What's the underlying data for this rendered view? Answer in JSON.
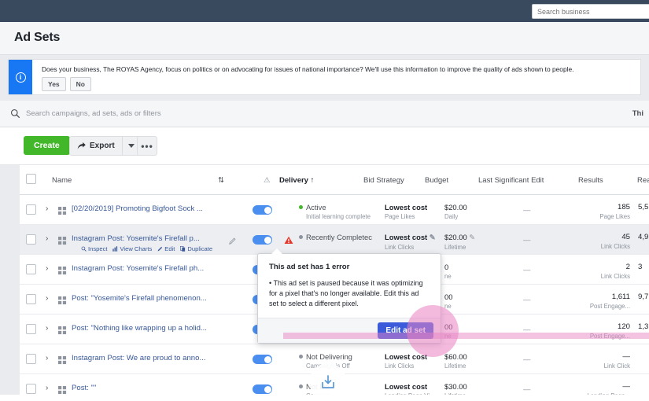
{
  "topbar": {
    "search_placeholder": "Search business"
  },
  "header": {
    "title": "Ad Sets"
  },
  "banner": {
    "icon": "info-icon",
    "text": "Does your business, The ROYAS Agency, focus on politics or on advocating for issues of national importance? We'll use this information to improve the quality of ads shown to people.",
    "yes_label": "Yes",
    "no_label": "No"
  },
  "search": {
    "placeholder": "Search campaigns, ad sets, ads or filters",
    "right_label": "Thi"
  },
  "toolbar": {
    "create_label": "Create",
    "export_label": "Export",
    "more_label": "•••"
  },
  "table": {
    "columns": {
      "name": "Name",
      "sort": "⇅",
      "warn": "⚠",
      "delivery": "Delivery ↑",
      "bid_strategy": "Bid Strategy",
      "budget": "Budget",
      "last_significant_edit": "Last Significant Edit",
      "results": "Results",
      "reach": "Rea"
    },
    "rows": [
      {
        "name": "[02/20/2019] Promoting Bigfoot Sock ...",
        "toggle": "on",
        "delivery": "Active",
        "delivery_sub": "Initial learning complete",
        "delivery_dot": "#42b72a",
        "bid": "Lowest cost",
        "bid_sub": "Page Likes",
        "budget": "$20.00",
        "budget_sub": "Daily",
        "last_edit": "—",
        "results": "185",
        "results_sub": "Page Likes",
        "reach": "5,5"
      },
      {
        "name": "Instagram Post: Yosemite's Firefall p...",
        "toggle": "on",
        "has_warning": true,
        "hovered": true,
        "actions": [
          "Inspect",
          "View Charts",
          "Edit",
          "Duplicate"
        ],
        "delivery": "Recently Completec",
        "delivery_sub": "",
        "delivery_dot": "#8d949e",
        "bid": "Lowest cost",
        "bid_sub": "Link Clicks",
        "budget": "$20.00",
        "budget_sub": "Lifetime",
        "last_edit": "—",
        "results": "45",
        "results_sub": "Link Clicks",
        "reach": "4,9"
      },
      {
        "name": "Instagram Post: Yosemite's Firefall ph...",
        "toggle": "on",
        "delivery": "",
        "delivery_sub": "",
        "bid": "",
        "bid_sub": "",
        "budget": "0",
        "budget_sub": "ne",
        "last_edit": "—",
        "results": "2",
        "results_sub": "Link Clicks",
        "reach": "3"
      },
      {
        "name": "Post: \"Yosemite's Firefall phenomenon...",
        "toggle": "on",
        "delivery": "",
        "delivery_sub": "",
        "bid": "",
        "bid_sub": "",
        "budget": "00",
        "budget_sub": "ne",
        "last_edit": "—",
        "results": "1,611",
        "results_sub": "Post Engage...",
        "reach": "9,7"
      },
      {
        "name": "Post: \"Nothing like wrapping up a holid...",
        "toggle": "on",
        "delivery": "",
        "delivery_sub": "",
        "bid": "",
        "bid_sub": "",
        "budget": "00",
        "budget_sub": "ne",
        "last_edit": "—",
        "results": "120",
        "results_sub": "Post Engage...",
        "reach": "1,3"
      },
      {
        "name": "Instagram Post: We are proud to anno...",
        "toggle": "on",
        "delivery": "Not Delivering",
        "delivery_sub": "Campaign is Off",
        "delivery_dot": "#8d949e",
        "bid": "Lowest cost",
        "bid_sub": "Link Clicks",
        "budget": "$60.00",
        "budget_sub": "Lifetime",
        "last_edit": "—",
        "results": "—",
        "results_sub": "Link Click",
        "reach": ""
      },
      {
        "name": "Post: \"\"",
        "toggle": "on",
        "delivery": "Not De",
        "delivery_sub": "Campaig",
        "delivery_dot": "#8d949e",
        "bid": "Lowest cost",
        "bid_sub": "Landing Page Vi...",
        "budget": "$30.00",
        "budget_sub": "Lifetime",
        "last_edit": "—",
        "results": "—",
        "results_sub": "Landing Page...",
        "reach": ""
      }
    ]
  },
  "popover": {
    "title": "This ad set has 1 error",
    "body": "• This ad set is paused because it was optimizing for a pixel that's no longer available. Edit this ad set to select a different pixel.",
    "button_label": "Edit ad set"
  },
  "overlay": {
    "download_icon": "download-icon"
  },
  "colors": {
    "accent_blue": "#1877f2",
    "create_green": "#42b72a",
    "link_blue": "#385898",
    "error_red": "#e1392d",
    "highlight_pink": "#e982c3",
    "topnav": "#3a4a5e"
  }
}
